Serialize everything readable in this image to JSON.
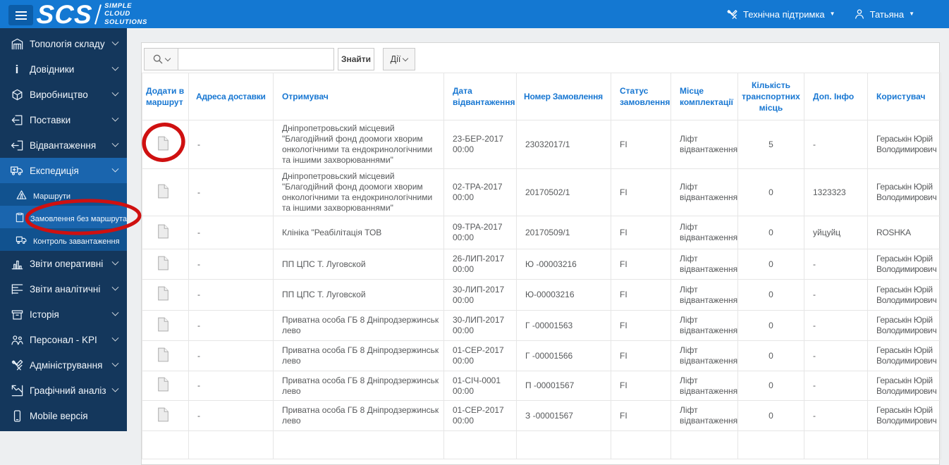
{
  "header": {
    "brand": {
      "acronym": "SCS",
      "words": [
        "SIMPLE",
        "CLOUD",
        "SOLUTIONS"
      ]
    },
    "support_label": "Технічна підтримка",
    "user_label": "Татьяна"
  },
  "sidebar": {
    "items": [
      {
        "label": "Топологія складу"
      },
      {
        "label": "Довідники"
      },
      {
        "label": "Виробництво"
      },
      {
        "label": "Поставки"
      },
      {
        "label": "Відвантаження"
      },
      {
        "label": "Експедиція"
      },
      {
        "label": "Звіти оперативні"
      },
      {
        "label": "Звіти аналітичні"
      },
      {
        "label": "Історія"
      },
      {
        "label": "Персонал - KPI"
      },
      {
        "label": "Адміністрування"
      },
      {
        "label": "Графічний аналіз"
      },
      {
        "label": "Mobile версія"
      }
    ],
    "expedition_submenu": [
      {
        "label": "Маршрути"
      },
      {
        "label": "Замовлення без маршрута"
      },
      {
        "label": "Контроль завантаження"
      }
    ]
  },
  "toolbar": {
    "find_button": "Знайти",
    "actions_button": "Дії"
  },
  "table": {
    "columns": [
      "Додати в маршрут",
      "Адреса доставки",
      "Отримувач",
      "Дата відвантаження",
      "Номер Замовлення",
      "Статус замовлення",
      "Місце комплектації",
      "Кількість транспортних місць",
      "Доп. Інфо",
      "Користувач"
    ],
    "rows": [
      {
        "address": "-",
        "receiver": "Дніпропетровьский місцевий \"Благодійний фонд доомоги хворим онкологічними та ендокринологічними та іншими захворюваннями\"",
        "date": "23-БЕР-2017",
        "time": "00:00",
        "order": "23032017/1",
        "status": "FI",
        "place": "Ліфт відвантаження",
        "qty": "5",
        "info": "-",
        "user": "Гераськін Юрій Володимирович"
      },
      {
        "address": "-",
        "receiver": "Дніпропетровьский місцевий \"Благодійний фонд доомоги хворим онкологічними та ендокринологічними та іншими захворюваннями\"",
        "date": "02-ТРА-2017",
        "time": "00:00",
        "order": "20170502/1",
        "status": "FI",
        "place": "Ліфт відвантаження",
        "qty": "0",
        "info": "1323323",
        "user": "Гераськін Юрій Володимирович"
      },
      {
        "address": "-",
        "receiver": "Клініка \"Реабілітація ТОВ",
        "date": "09-ТРА-2017",
        "time": "00:00",
        "order": "20170509/1",
        "status": "FI",
        "place": "Ліфт відвантаження",
        "qty": "0",
        "info": "уйцуйц",
        "user": "ROSHKA"
      },
      {
        "address": "-",
        "receiver": "ПП ЦПС Т. Луговской",
        "date": "26-ЛИП-2017",
        "time": "00:00",
        "order": "Ю -00003216",
        "status": "FI",
        "place": "Ліфт відвантаження",
        "qty": "0",
        "info": "-",
        "user": "Гераськін Юрій Володимирович"
      },
      {
        "address": "-",
        "receiver": "ПП ЦПС Т. Луговской",
        "date": "30-ЛИП-2017",
        "time": "00:00",
        "order": "Ю-00003216",
        "status": "FI",
        "place": "Ліфт відвантаження",
        "qty": "0",
        "info": "-",
        "user": "Гераськін Юрій Володимирович"
      },
      {
        "address": "-",
        "receiver": "Приватна особа ГБ 8 Дніпродзержинськ лево",
        "date": "30-ЛИП-2017",
        "time": "00:00",
        "order": "Г -00001563",
        "status": "FI",
        "place": "Ліфт відвантаження",
        "qty": "0",
        "info": "-",
        "user": "Гераськін Юрій Володимирович"
      },
      {
        "address": "-",
        "receiver": "Приватна особа ГБ 8 Дніпродзержинськ лево",
        "date": "01-СЕР-2017",
        "time": "00:00",
        "order": "Г -00001566",
        "status": "FI",
        "place": "Ліфт відвантаження",
        "qty": "0",
        "info": "-",
        "user": "Гераськін Юрій Володимирович"
      },
      {
        "address": "-",
        "receiver": "Приватна особа ГБ 8 Дніпродзержинськ лево",
        "date": "01-СІЧ-0001",
        "time": "00:00",
        "order": "П -00001567",
        "status": "FI",
        "place": "Ліфт відвантаження",
        "qty": "0",
        "info": "-",
        "user": "Гераськін Юрій Володимирович"
      },
      {
        "address": "-",
        "receiver": "Приватна особа ГБ 8 Дніпродзержинськ лево",
        "date": "01-СЕР-2017",
        "time": "00:00",
        "order": "З -00001567",
        "status": "FI",
        "place": "Ліфт відвантаження",
        "qty": "0",
        "info": "-",
        "user": "Гераськін Юрій Володимирович"
      }
    ]
  },
  "annotations": {
    "color": "#cf1010"
  }
}
